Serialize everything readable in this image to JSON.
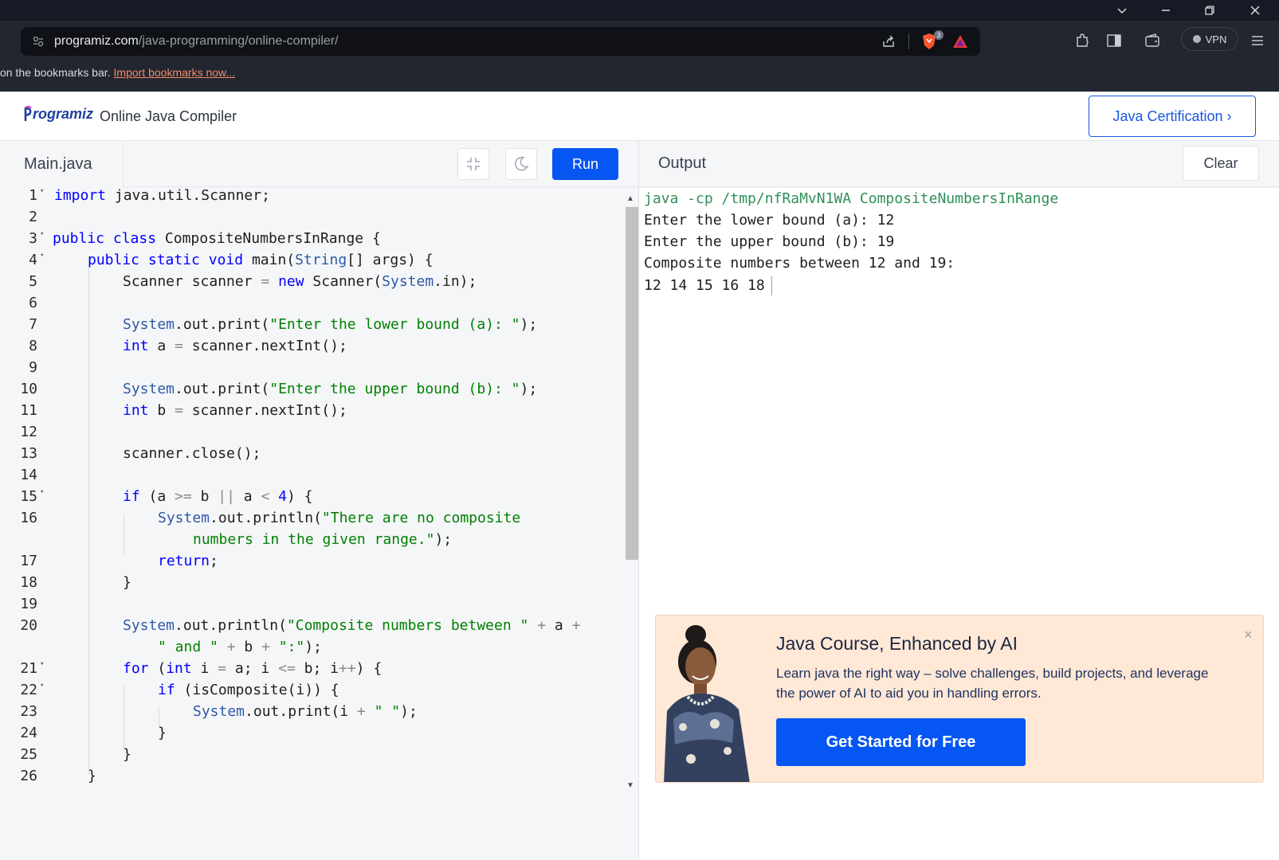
{
  "browser": {
    "url_host": "programiz.com",
    "url_path": "/java-programming/online-compiler/",
    "vpn_label": "VPN",
    "shield_badge": "3",
    "bookmarks_text": "on the bookmarks bar.",
    "bookmarks_link": "Import bookmarks now..."
  },
  "site": {
    "logo_text": "rogramiz",
    "title": "Online Java Compiler",
    "cert_button": "Java Certification ›"
  },
  "editor": {
    "file_tab": "Main.java",
    "run_label": "Run",
    "line_numbers": [
      "1",
      "2",
      "3",
      "4",
      "5",
      "6",
      "7",
      "8",
      "9",
      "10",
      "11",
      "12",
      "13",
      "14",
      "15",
      "16",
      "17",
      "18",
      "19",
      "20",
      "21",
      "22",
      "23",
      "24",
      "25",
      "26"
    ]
  },
  "output": {
    "title": "Output",
    "clear_label": "Clear",
    "lines": [
      "java -cp /tmp/nfRaMvN1WA CompositeNumbersInRange",
      "Enter the lower bound (a): 12",
      "Enter the upper bound (b): 19",
      "Composite numbers between 12 and 19:",
      "12 14 15 16 18"
    ]
  },
  "ad": {
    "title": "Java Course, Enhanced by AI",
    "description": "Learn java the right way – solve challenges, build projects, and leverage the power of AI to aid you in handling errors.",
    "cta": "Get Started for Free",
    "close": "×"
  },
  "colors": {
    "accent": "#0556f3",
    "keyword": "#0000ff",
    "string": "#008000",
    "command": "#2f8f5a"
  }
}
